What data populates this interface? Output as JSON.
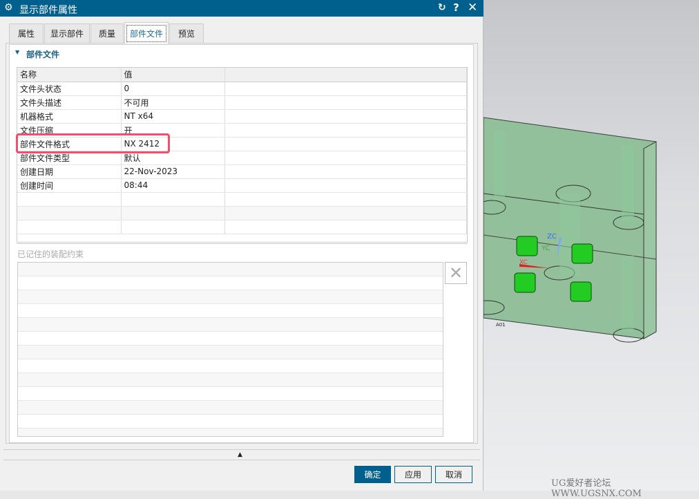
{
  "dialog": {
    "title": "显示部件属性",
    "tabs": [
      "属性",
      "显示部件",
      "质量",
      "部件文件",
      "预览"
    ],
    "active_tab": "部件文件",
    "section_title": "部件文件",
    "table": {
      "headers": [
        "名称",
        "值"
      ],
      "rows": [
        [
          "文件头状态",
          "0"
        ],
        [
          "文件头描述",
          "不可用"
        ],
        [
          "机器格式",
          "NT x64"
        ],
        [
          "文件压缩",
          "开"
        ],
        [
          "部件文件格式",
          "NX 2412"
        ],
        [
          "部件文件类型",
          "默认"
        ],
        [
          "创建日期",
          "22-Nov-2023"
        ],
        [
          "创建时间",
          "08:44"
        ]
      ]
    },
    "constraints_label": "已记住的装配约束",
    "buttons": {
      "ok": "确定",
      "apply": "应用",
      "cancel": "取消"
    }
  },
  "viewport": {
    "axes": {
      "x": "XC",
      "y": "YC",
      "z": "ZC"
    },
    "part_label": "A01",
    "watermark": "UG爱好者论坛 WWW.UGSNX.COM"
  },
  "colors": {
    "titlebar": "#00608d",
    "highlight": "#f0506e"
  }
}
